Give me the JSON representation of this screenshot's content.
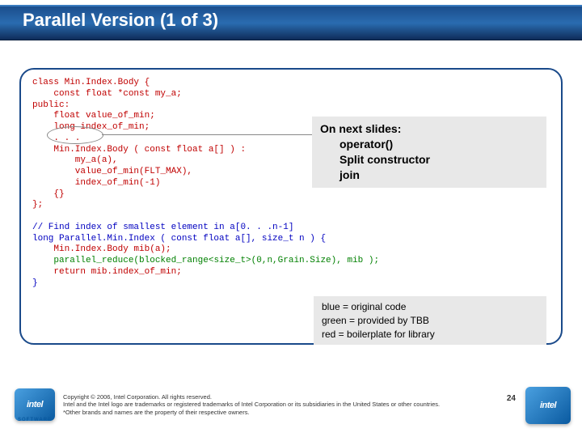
{
  "brand": "Intel® Software College",
  "title": "Parallel Version (1 of 3)",
  "code": {
    "l1": "class Min.Index.Body {",
    "l2": "    const float *const my_a;",
    "l3": "public:",
    "l4": "    float value_of_min;",
    "l5": "    long index_of_min;",
    "l6": "    . . .",
    "l7": "    Min.Index.Body ( const float a[] ) :",
    "l8": "        my_a(a),",
    "l9": "        value_of_min(FLT_MAX),",
    "l10": "        index_of_min(-1)",
    "l11": "    {}",
    "l12": "};",
    "l13": "",
    "l14": "// Find index of smallest element in a[0. . .n-1]",
    "l15": "long Parallel.Min.Index ( const float a[], size_t n ) {",
    "l16": "    Min.Index.Body mib(a);",
    "l17a": "    ",
    "l17b": "parallel_reduce(blocked_range<size_t>(0,n,Grain.Size), mib );",
    "l18": "    return mib.index_of_min;",
    "l19": "}"
  },
  "callout": {
    "heading": "On next slides:",
    "item1": "operator()",
    "item2": "Split constructor",
    "item3": "join"
  },
  "legend": {
    "line1": "blue = original code",
    "line2": "green = provided by TBB",
    "line3": "red = boilerplate for library"
  },
  "footer": {
    "copyright_l1": "Copyright © 2006, Intel Corporation. All rights reserved.",
    "copyright_l2": "Intel and the Intel logo are trademarks or registered trademarks of Intel Corporation or its subsidiaries in the United States or other countries. *Other brands and names are the property of their respective owners.",
    "page": "24",
    "logo_text": "intel",
    "software_label": "SOFTWARE"
  }
}
